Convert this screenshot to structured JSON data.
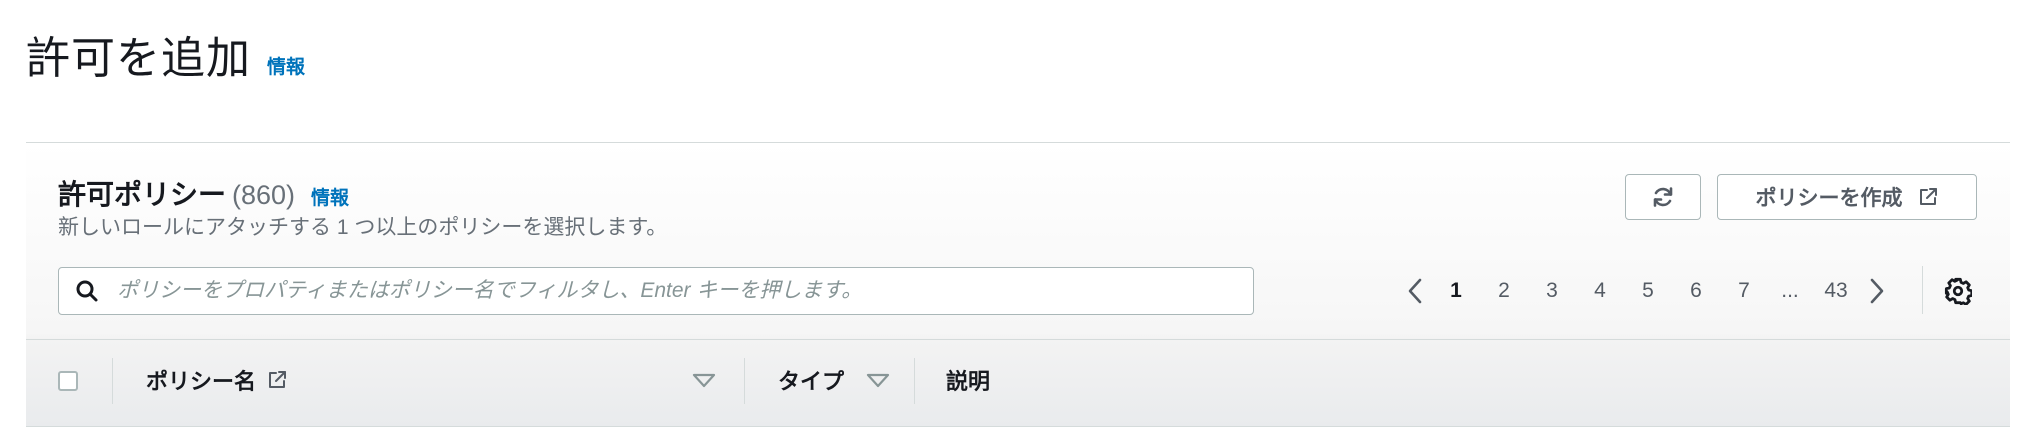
{
  "page": {
    "title": "許可を追加",
    "info": "情報"
  },
  "section": {
    "title": "許可ポリシー",
    "count": "(860)",
    "info": "情報",
    "description": "新しいロールにアタッチする 1 つ以上のポリシーを選択します。"
  },
  "buttons": {
    "create_policy": "ポリシーを作成"
  },
  "search": {
    "placeholder": "ポリシーをプロパティまたはポリシー名でフィルタし、Enter キーを押します。",
    "value": ""
  },
  "pagination": {
    "pages": [
      "1",
      "2",
      "3",
      "4",
      "5",
      "6",
      "7"
    ],
    "ellipsis": "...",
    "last": "43",
    "current": "1"
  },
  "table": {
    "columns": {
      "name": "ポリシー名",
      "type": "タイプ",
      "description": "説明"
    }
  },
  "colors": {
    "link": "#0073bb",
    "text": "#16191f",
    "secondary": "#687078",
    "border": "#aab7b8"
  },
  "icons": [
    "refresh-icon",
    "external-link-icon",
    "search-icon",
    "chevron-left-icon",
    "chevron-right-icon",
    "settings-icon",
    "sort-icon"
  ]
}
